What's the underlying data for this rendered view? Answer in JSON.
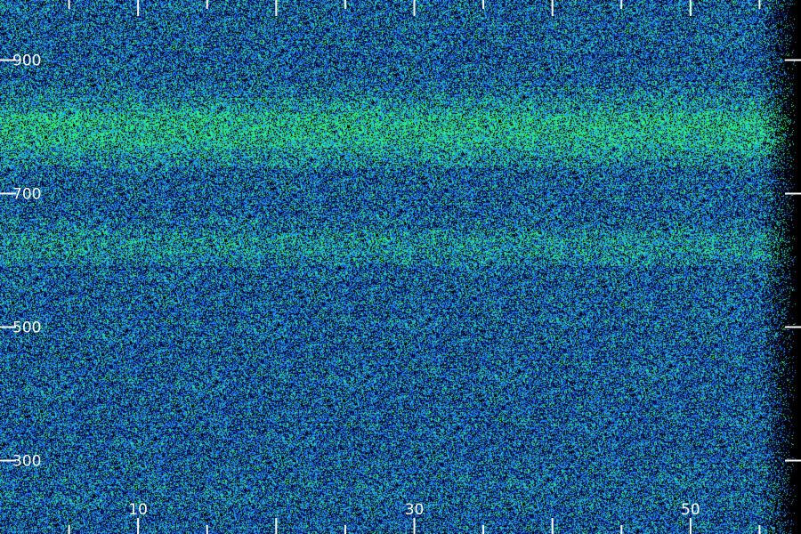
{
  "chart_data": {
    "type": "heatmap",
    "title": "",
    "xlabel": "",
    "ylabel": "",
    "x_ticks": [
      10,
      30,
      50
    ],
    "y_ticks": [
      900,
      700,
      500,
      300
    ],
    "xlim": [
      0,
      58
    ],
    "ylim": [
      190,
      990
    ],
    "grid": false,
    "legend": "none",
    "colors": {
      "background": "#000000",
      "low": "#0a1a7a",
      "mid": "#1e8cf0",
      "high": "#2ef07a"
    },
    "features": [
      {
        "kind": "bright-band",
        "y_center": 795,
        "y_halfwidth": 45,
        "strength": 1.0
      },
      {
        "kind": "bright-band",
        "y_center": 625,
        "y_halfwidth": 25,
        "strength": 0.5
      },
      {
        "kind": "dark-fade-edge",
        "x_start": 55
      }
    ]
  }
}
